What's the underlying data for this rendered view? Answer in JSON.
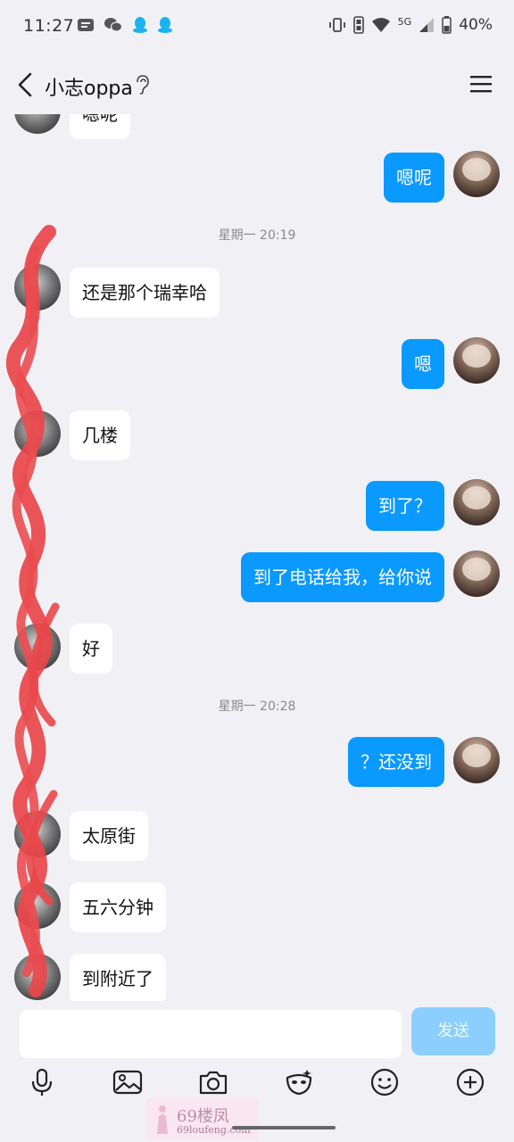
{
  "status_bar": {
    "time": "11:27",
    "network": "5G",
    "battery": "40%"
  },
  "header": {
    "contact_name": "小志oppa"
  },
  "timestamps": [
    "星期一 20:19",
    "星期一 20:28"
  ],
  "messages": [
    {
      "side": "left",
      "text": "嗯呢"
    },
    {
      "side": "right",
      "text": "嗯呢"
    },
    {
      "side": "left",
      "text": "还是那个瑞幸哈"
    },
    {
      "side": "right",
      "text": "嗯"
    },
    {
      "side": "left",
      "text": "几楼"
    },
    {
      "side": "right",
      "text": "到了？"
    },
    {
      "side": "right",
      "text": "到了电话给我，给你说"
    },
    {
      "side": "left",
      "text": "好"
    },
    {
      "side": "right",
      "text": "？还没到"
    },
    {
      "side": "left",
      "text": "太原街"
    },
    {
      "side": "left",
      "text": "五六分钟"
    },
    {
      "side": "left",
      "text": "到附近了"
    }
  ],
  "input": {
    "value": "",
    "send_label": "发送"
  },
  "toolbar": [
    "microphone-icon",
    "image-icon",
    "camera-icon",
    "sticker-icon",
    "emoji-icon",
    "plus-icon"
  ],
  "watermark": {
    "title": "69楼凤",
    "url": "69loufeng.com"
  },
  "colors": {
    "accent": "#0a99ff",
    "bubble_left": "#ffffff",
    "background": "#f1f1f5",
    "send_disabled": "#8ccfff"
  }
}
